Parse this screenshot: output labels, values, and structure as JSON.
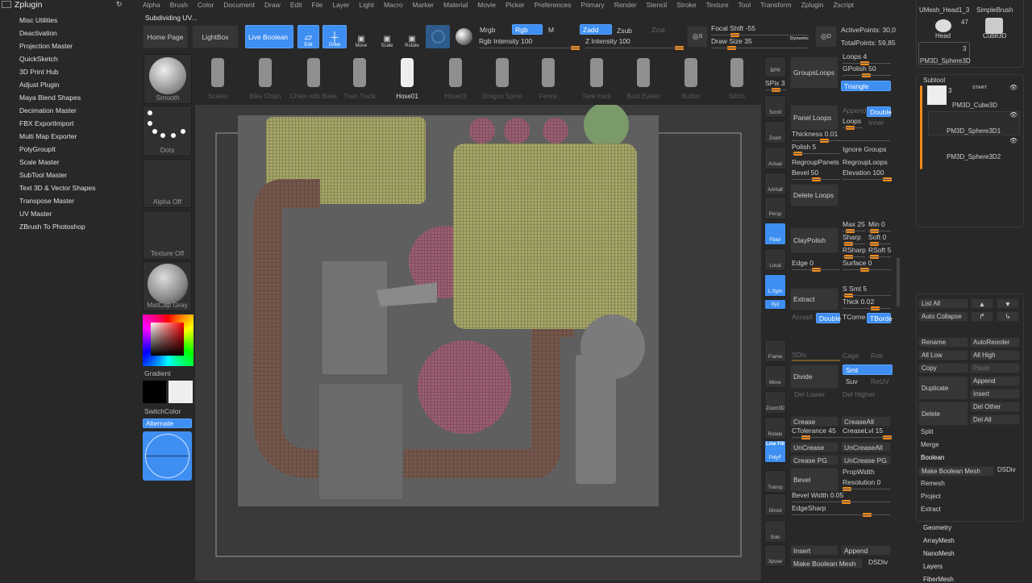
{
  "menu": [
    "Alpha",
    "Brush",
    "Color",
    "Document",
    "Draw",
    "Edit",
    "File",
    "Layer",
    "Light",
    "Macro",
    "Marker",
    "Material",
    "Movie",
    "Picker",
    "Preferences",
    "Primary",
    "Render",
    "Stencil",
    "Stroke",
    "Texture",
    "Tool",
    "Transform",
    "Zplugin",
    "Zscript"
  ],
  "status": "Subdividing UV...",
  "zplugin": {
    "title": "Zplugin",
    "items": [
      "Misc Utilities",
      "Deactivation",
      "Projection Master",
      "QuickSketch",
      "3D Print Hub",
      "Adjust Plugin",
      "Maya Blend Shapes",
      "Decimation Master",
      "FBX ExportImport",
      "Multi Map Exporter",
      "PolyGroupIt",
      "Scale Master",
      "SubTool Master",
      "Text 3D & Vector Shapes",
      "Transpose Master",
      "UV Master",
      "ZBrush To Photoshop"
    ]
  },
  "toolbar": {
    "home": "Home Page",
    "lightbox": "LightBox",
    "live_boolean": "Live Boolean",
    "edit": "Edit",
    "draw": "Draw",
    "move": "Move",
    "scale": "Scale",
    "rotate": "Rotate",
    "mrgb": "Mrgb",
    "rgb": "Rgb",
    "m": "M",
    "zadd": "Zadd",
    "zsub": "Zsub",
    "zcut": "Zcut",
    "rgb_intensity": "Rgb Intensity 100",
    "z_intensity": "Z Intensity 100",
    "focal_shift": "Focal Shift -55",
    "draw_size": "Draw Size 35",
    "dynamic": "Dynamic",
    "active_points": "ActivePoints: 30,0",
    "total_points": "TotalPoints: 59,85",
    "s": "S",
    "d": "D"
  },
  "brushes": [
    "Scales",
    "Bike Chain",
    "Chain with Base",
    "Train Track",
    "Hose01",
    "Hose02",
    "Dragon Spine",
    "Fence",
    "Tank track",
    "Boot Eyelet",
    "Button",
    "Stitch"
  ],
  "left": {
    "smooth": "Smooth",
    "dots": "Dots",
    "alpha": "Alpha Off",
    "texture": "Texture Off",
    "matcap": "MatCap Gray",
    "gradient": "Gradient",
    "switch": "SwitchColor",
    "alternate": "Alternate"
  },
  "nav": {
    "bpr": "BPR",
    "spix": "SPix 3",
    "items": [
      "Scroll",
      "Zoom",
      "Actual",
      "AAHalf",
      "Persp",
      "Floor",
      "Local",
      "L.Sym",
      "Xyz",
      "Frame",
      "Move",
      "Zoom3D",
      "Rotate",
      "PolyF",
      "Transp",
      "Ghost",
      "Solo",
      "Xpose"
    ],
    "dynamic": "Dynamic",
    "linefill": "Line Fill"
  },
  "geom": {
    "groupsloops": "GroupsLoops",
    "loops4": "Loops 4",
    "gpolish": "GPolish 50",
    "triangle": "Triangle",
    "panelloops": "Panel Loops",
    "append": "Append",
    "double": "Double",
    "loops": "Loops",
    "inner": "Inner",
    "thickness": "Thickness 0.01",
    "polish": "Polish 5",
    "ignore": "Ignore Groups",
    "regroupPanels": "RegroupPanels",
    "regroupLoops": "RegroupLoops",
    "bevel50": "Bevel 50",
    "elevation": "Elevation 100",
    "deleteloops": "Delete Loops",
    "claypolish": "ClayPolish",
    "max": "Max 25",
    "min": "Min 0",
    "sharp": "Sharp",
    "soft": "Soft 0",
    "rsharp": "RSharp",
    "rsoft": "RSoft 5",
    "edge": "Edge 0",
    "surface": "Surface 0",
    "extract": "Extract",
    "ssmt": "S Smt 5",
    "thick": "Thick 0.02",
    "accept": "Accept",
    "double2": "Double",
    "tcorne": "TCorne",
    "tborde": "TBorde",
    "sdiv": "SDiv",
    "cage": "Cage",
    "rstr": "Rstr",
    "divide": "Divide",
    "smt": "Smt",
    "suv": "Suv",
    "reuv": "ReUV",
    "dellower": "Del Lower",
    "delhigher": "Del Higher",
    "crease": "Crease",
    "creaseall": "CreaseAll",
    "ctol": "CTolerance 45",
    "creaselvl": "CreaseLvl 15",
    "uncrease": "UnCrease",
    "uncreaseall": "UnCreaseAll",
    "creasepg": "Crease PG",
    "uncreasepg": "UnCrease PG",
    "bevel": "Bevel",
    "propwidth": "PropWidth",
    "resolution": "Resolution 0",
    "bevelwidth": "Bevel Width 0.05",
    "edgesharp": "EdgeSharp",
    "insert": "Insert",
    "append2": "Append",
    "makebool": "Make Boolean Mesh",
    "dsdiv": "DSDiv"
  },
  "tools": {
    "umesh": "UMesh_Head1_3",
    "simplebrush": "SimpleBrush",
    "head": "Head",
    "head_count": "47",
    "cube": "Cube3D",
    "pm3d": "PM3D_Sphere3D",
    "pm3d_count": "3"
  },
  "subtool": {
    "title": "Subtool",
    "start": "START",
    "items": [
      {
        "name": "PM3D_Cube3D",
        "count": "3"
      },
      {
        "name": "PM3D_Sphere3D1"
      },
      {
        "name": "PM3D_Sphere3D2"
      }
    ],
    "listall": "List All",
    "autocollapse": "Auto Collapse",
    "rename": "Rename",
    "autoreorder": "AutoReorder",
    "alllow": "All Low",
    "allhigh": "All High",
    "copy": "Copy",
    "paste": "Paste",
    "duplicate": "Duplicate",
    "append": "Append",
    "insert": "Insert",
    "delete": "Delete",
    "delother": "Del Other",
    "delall": "Del All",
    "split": "Split",
    "merge": "Merge",
    "boolean": "Boolean",
    "makebool": "Make Boolean Mesh",
    "dsdiv": "DSDiv",
    "remesh": "Remesh",
    "project": "Project",
    "extract": "Extract"
  },
  "sections": [
    "Geometry",
    "ArrayMesh",
    "NanoMesh",
    "Layers",
    "FiberMesh"
  ],
  "colors": {
    "accent": "#3f8ff2",
    "slider": "#f08a1c",
    "bg": "#282828"
  }
}
